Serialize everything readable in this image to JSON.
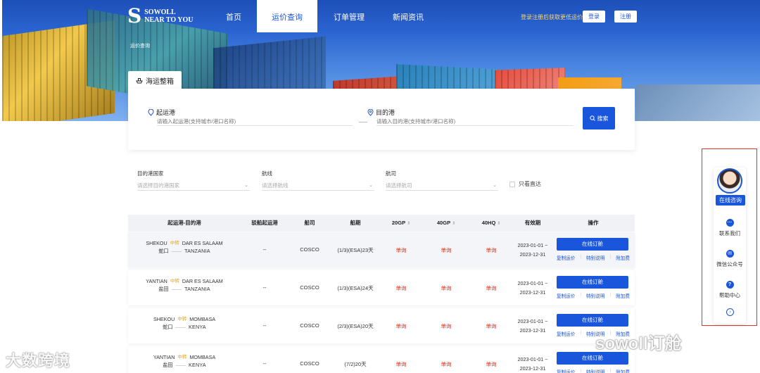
{
  "header": {
    "logo_letter": "S",
    "logo_line1": "SOWOLL",
    "logo_line2": "NEAR TO YOU",
    "nav": [
      "首页",
      "运价查询",
      "订单管理",
      "新闻资讯"
    ],
    "register_tip": "登录注册后获取更低运价",
    "login_label": "登录",
    "register_label": "注册",
    "breadcrumb": "运价查询"
  },
  "search": {
    "tab_label": "海运整箱",
    "origin_label": "起运港",
    "origin_placeholder": "请输入起运港(支持城市/港口名称)",
    "dest_label": "目的港",
    "dest_placeholder": "请输入目的港(支持城市/港口名称)",
    "search_button": "搜索"
  },
  "filters": {
    "country_label": "目的港国家",
    "country_placeholder": "请选择目的港国家",
    "route_label": "航线",
    "route_placeholder": "请选择航线",
    "carrier_label": "航司",
    "carrier_placeholder": "请选择航司",
    "direct_only": "只看直达"
  },
  "table": {
    "headers": [
      "起运港-目的港",
      "驳船起运港",
      "船司",
      "船期",
      "20GP",
      "40GP",
      "40HQ",
      "有效期",
      "操作"
    ],
    "book_label": "在线订舱",
    "link_copy": "复制运价",
    "link_special": "特别说明",
    "link_surcharge": "附加费",
    "rows": [
      {
        "from_en": "SHEKOU",
        "from_cn": "蛇口",
        "transit": "中转",
        "to_en": "DAR ES SALAAM",
        "to_country": "TANZANIA",
        "feeder": "--",
        "carrier": "COSCO",
        "schedule": "(1/3)(ESA)23天",
        "gp20": "单询",
        "gp40": "单询",
        "hq40": "单询",
        "valid_from": "2023-01-01 ~",
        "valid_to": "2023-12-31"
      },
      {
        "from_en": "YANTIAN",
        "from_cn": "盐田",
        "transit": "中转",
        "to_en": "DAR ES SALAAM",
        "to_country": "TANZANIA",
        "feeder": "--",
        "carrier": "COSCO",
        "schedule": "(1/3)(ESA)24天",
        "gp20": "单询",
        "gp40": "单询",
        "hq40": "单询",
        "valid_from": "2023-01-01 ~",
        "valid_to": "2023-12-31"
      },
      {
        "from_en": "SHEKOU",
        "from_cn": "蛇口",
        "transit": "中转",
        "to_en": "MOMBASA",
        "to_country": "KENYA",
        "feeder": "--",
        "carrier": "COSCO",
        "schedule": "(2/3)(ESA)20天",
        "gp20": "单询",
        "gp40": "单询",
        "hq40": "单询",
        "valid_from": "2023-01-01 ~",
        "valid_to": "2023-12-31"
      },
      {
        "from_en": "YANTIAN",
        "from_cn": "盐田",
        "transit": "中转",
        "to_en": "MOMBASA",
        "to_country": "KENYA",
        "feeder": "--",
        "carrier": "COSCO",
        "schedule": "(7/2)20天",
        "gp20": "单询",
        "gp40": "单询",
        "hq40": "单询",
        "valid_from": "2023-01-01 ~",
        "valid_to": "2023-12-31"
      }
    ]
  },
  "float_widget": {
    "consult": "在线咨询",
    "contact": "联系我们",
    "wechat": "微信公众号",
    "help": "帮助中心"
  },
  "watermarks": {
    "left": "大数跨境",
    "right": "sowoll订舱"
  },
  "colors": {
    "brand_blue": "#1a56db",
    "price_red": "#e0321d",
    "transit_orange": "#e8a317",
    "highlight_red": "#e0302a"
  }
}
